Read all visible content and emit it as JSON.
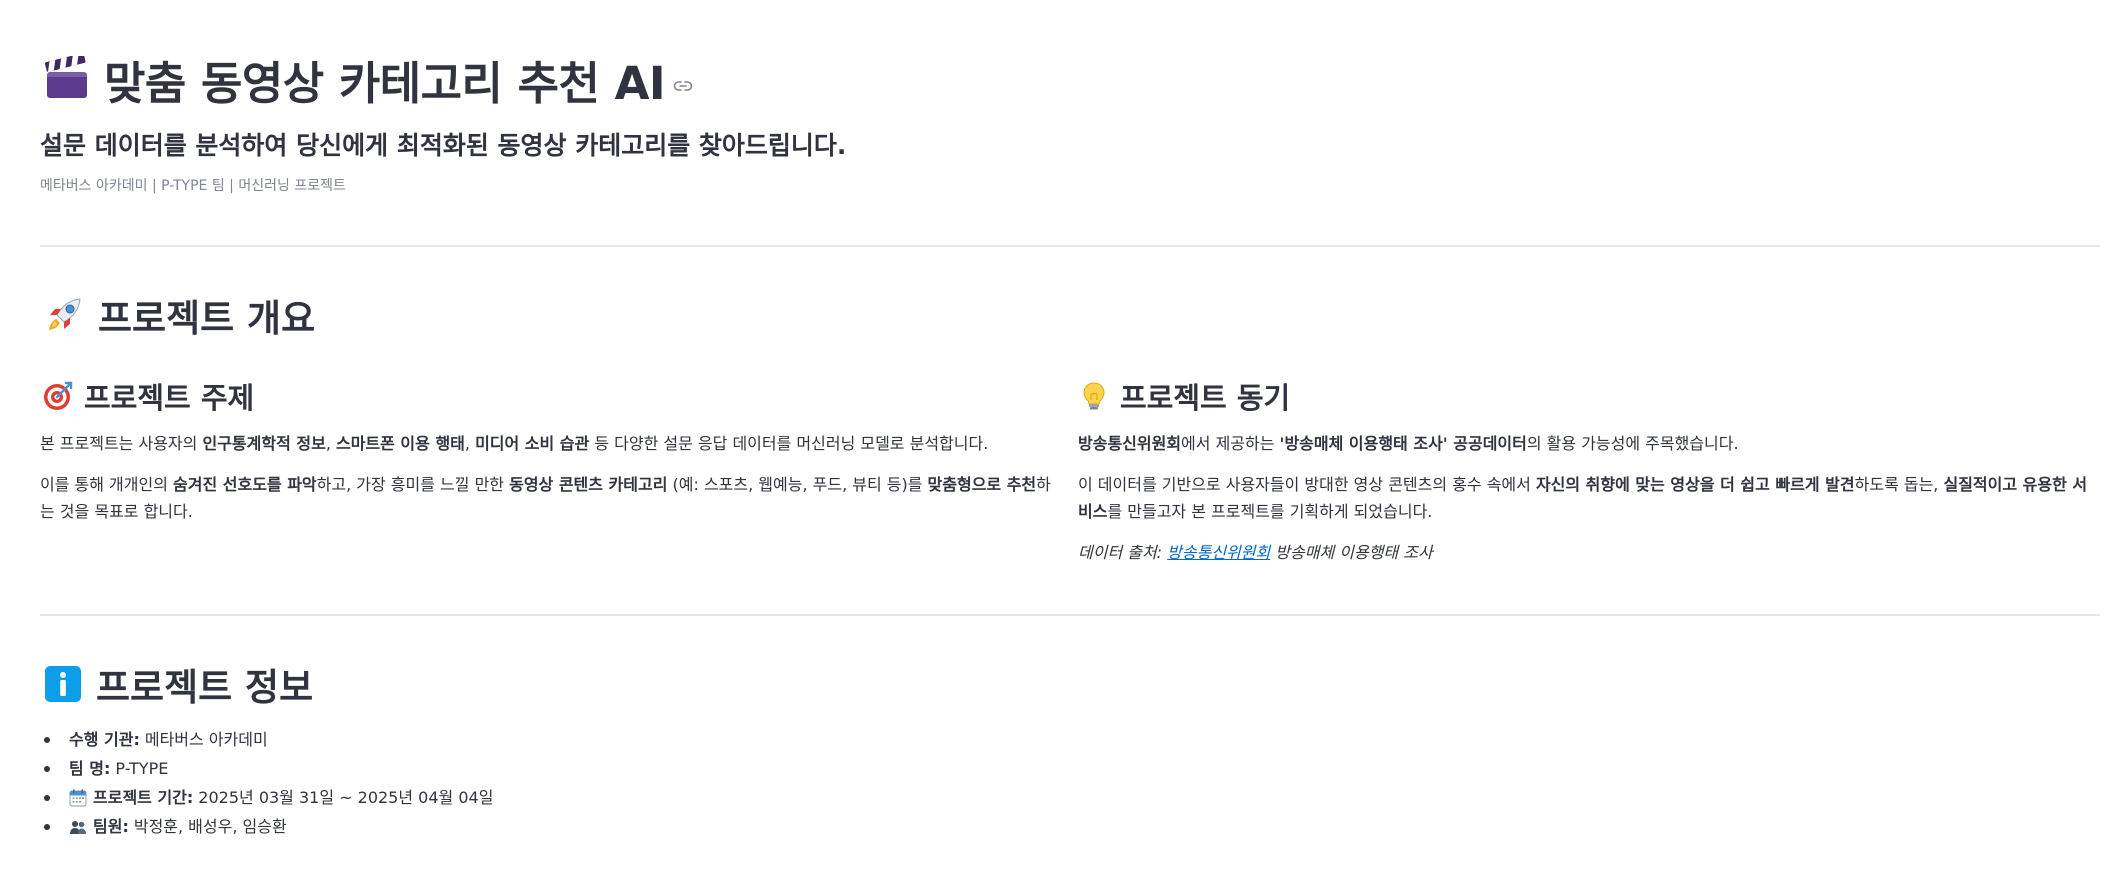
{
  "header": {
    "title": "맞춤 동영상 카테고리 추천 AI",
    "subtitle": "설문 데이터를 분석하여 당신에게 최적화된 동영상 카테고리를 찾아드립니다.",
    "caption": "메타버스 아카데미 | P-TYPE 팀 | 머신러닝 프로젝트",
    "title_icon": "clapper-board-icon",
    "anchor_icon": "link-icon"
  },
  "overview": {
    "title": "프로젝트 개요",
    "icon": "rocket-icon",
    "topic": {
      "title": "프로젝트 주제",
      "icon": "target-icon",
      "p1": {
        "t1": "본 프로젝트는 사용자의 ",
        "b1": "인구통계학적 정보",
        "t2": ", ",
        "b2": "스마트폰 이용 행태",
        "t3": ", ",
        "b3": "미디어 소비 습관",
        "t4": " 등 다양한 설문 응답 데이터를 머신러닝 모델로 분석합니다."
      },
      "p2": {
        "t1": "이를 통해 개개인의 ",
        "b1": "숨겨진 선호도를 파악",
        "t2": "하고, 가장 흥미를 느낄 만한 ",
        "b2": "동영상 콘텐츠 카테고리",
        "t3": " (예: 스포츠, 웹예능, 푸드, 뷰티 등)를 ",
        "b3": "맞춤형으로 추천",
        "t4": "하는 것을 목표로 합니다."
      }
    },
    "motive": {
      "title": "프로젝트 동기",
      "icon": "light-bulb-icon",
      "p1": {
        "b1": "방송통신위원회",
        "t1": "에서 제공하는 ",
        "b2": "'방송매체 이용행태 조사' 공공데이터",
        "t2": "의 활용 가능성에 주목했습니다."
      },
      "p2": {
        "t1": "이 데이터를 기반으로 사용자들이 방대한 영상 콘텐츠의 홍수 속에서 ",
        "b1": "자신의 취향에 맞는 영상을 더 쉽고 빠르게 발견",
        "t2": "하도록 돕는, ",
        "b2": "실질적이고 유용한 서비스",
        "t3": "를 만들고자 본 프로젝트를 기획하게 되었습니다."
      },
      "source": {
        "prefix": "데이터 출처: ",
        "link": "방송통신위원회",
        "suffix": " 방송매체 이용행태 조사"
      }
    }
  },
  "info": {
    "title": "프로젝트 정보",
    "icon": "info-icon",
    "items": [
      {
        "label": "수행 기관:",
        "value": "메타버스 아카데미",
        "icon": ""
      },
      {
        "label": "팀 명:",
        "value": "P-TYPE",
        "icon": ""
      },
      {
        "label": "프로젝트 기간:",
        "value": "2025년 03월 31일 ~ 2025년 04월 04일",
        "icon": "calendar-icon"
      },
      {
        "label": "팀원:",
        "value": "박정훈, 배성우, 임승환",
        "icon": "people-icon"
      }
    ]
  },
  "colors": {
    "text": "#31333f",
    "caption": "#808495",
    "link": "#0068c9",
    "divider": "#e6e6ea",
    "info_blue": "#0c9ee8"
  }
}
